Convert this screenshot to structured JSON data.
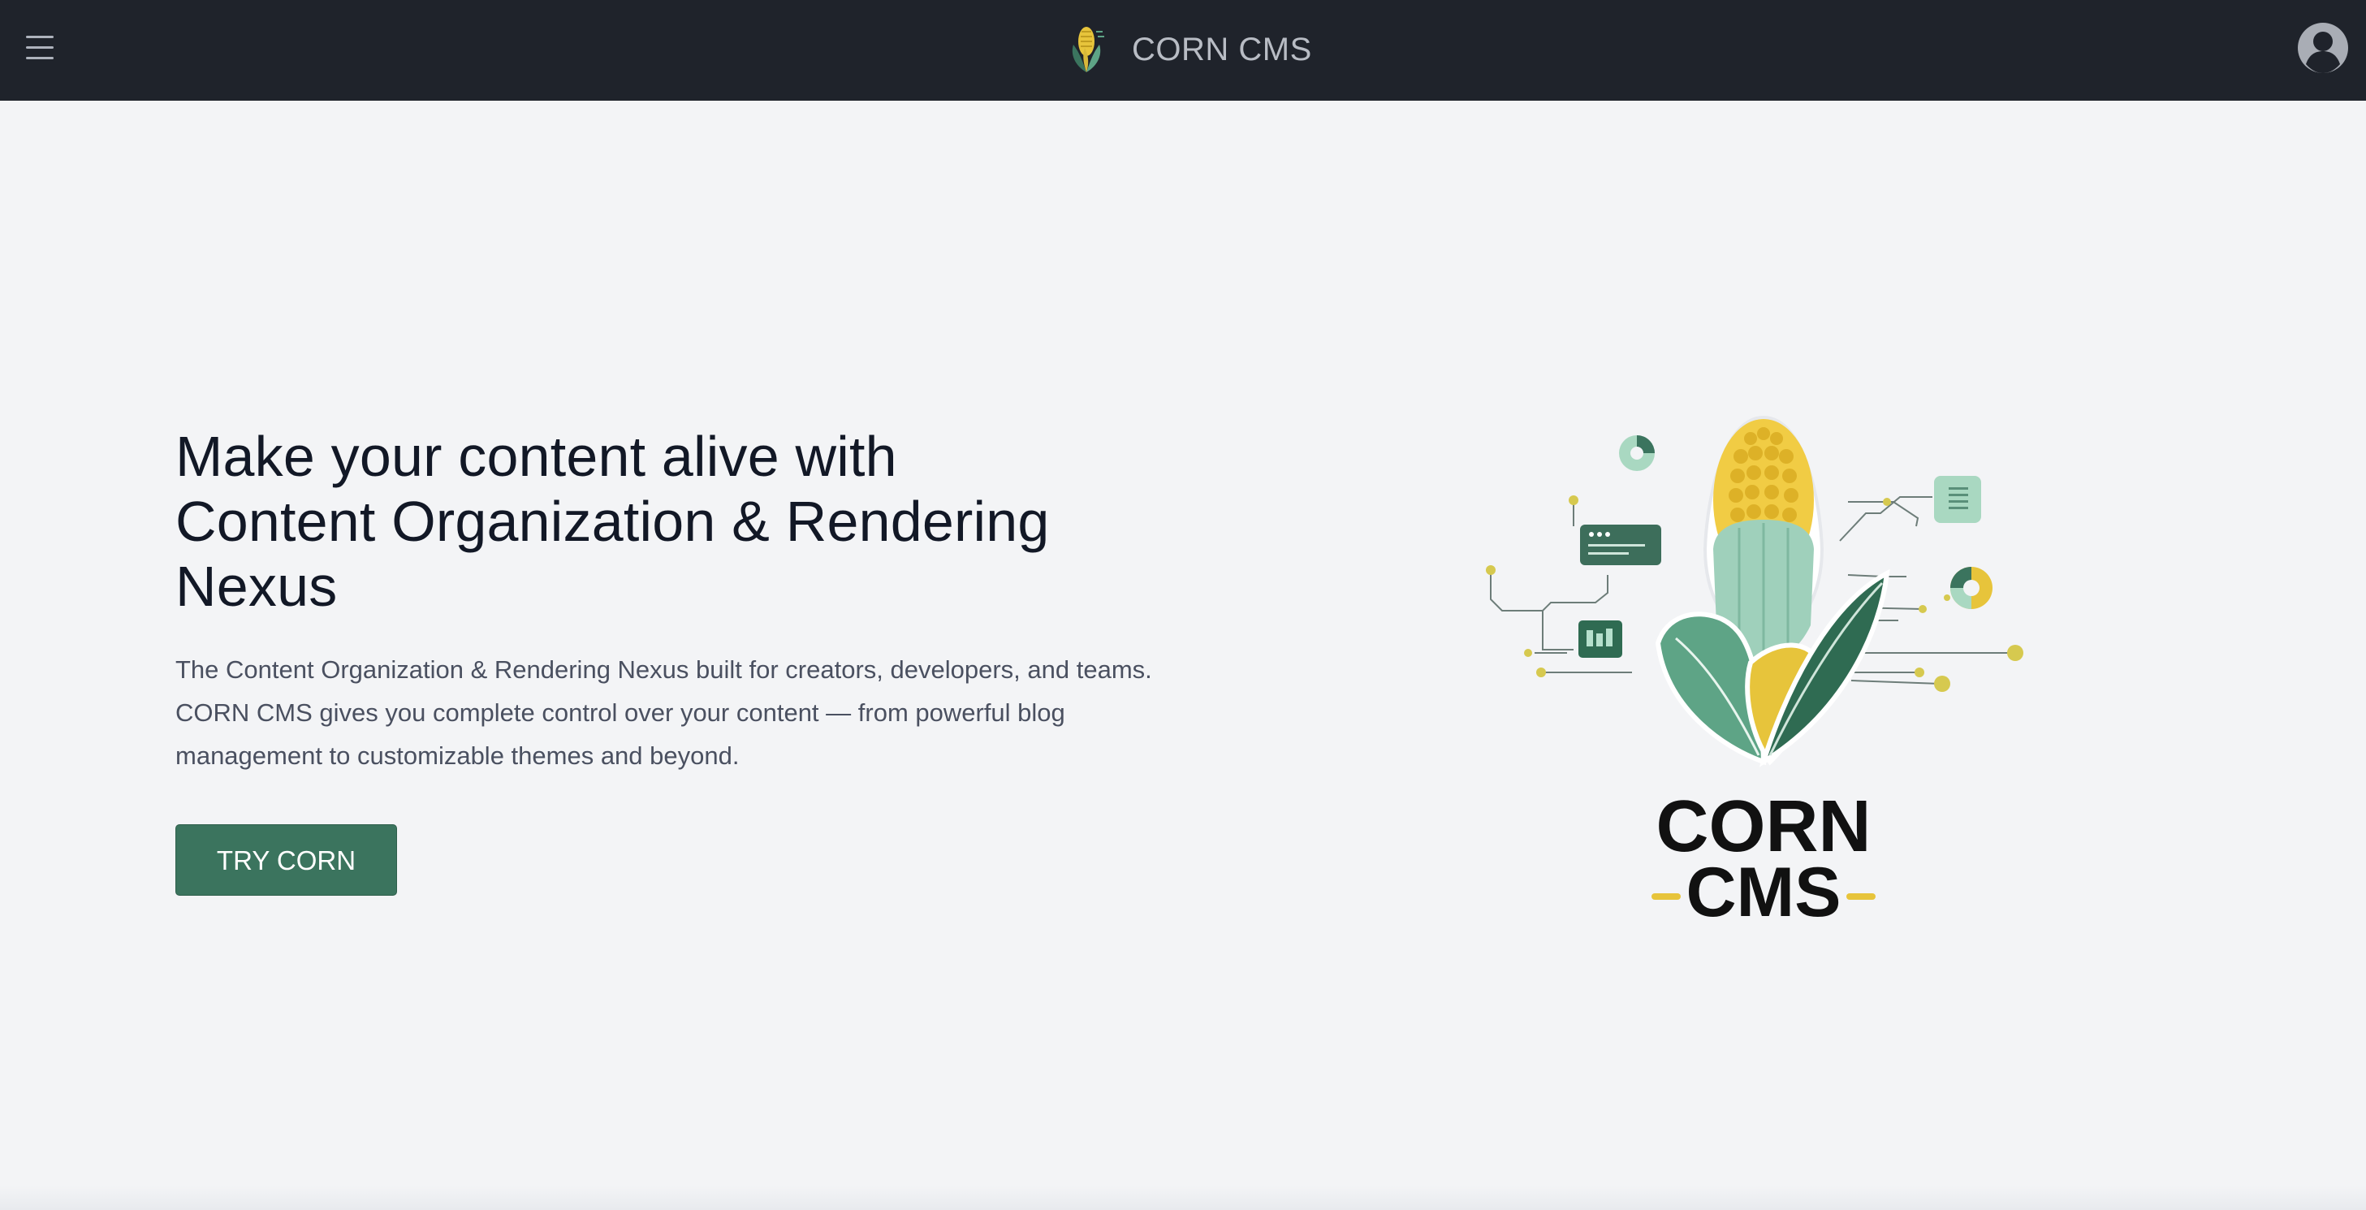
{
  "header": {
    "brand": "CORN CMS",
    "menu_icon": "hamburger-menu-icon",
    "avatar_icon": "user-avatar-icon"
  },
  "hero": {
    "title_lines": [
      "Make your content alive with",
      "Content Organization & Rendering",
      "Nexus"
    ],
    "description_lines": [
      "The Content Organization & Rendering Nexus built for creators, developers, and teams.",
      "CORN CMS gives you complete control over your content — from powerful blog",
      "management to customizable themes and beyond."
    ],
    "cta_label": "TRY CORN"
  },
  "illustration": {
    "logo_line1": "CORN",
    "logo_line2": "CMS"
  },
  "colors": {
    "header_bg": "#1f232b",
    "page_bg": "#f3f4f6",
    "accent": "#3b745e",
    "corn_yellow": "#e7c43b",
    "leaf_green": "#2f6b52"
  }
}
